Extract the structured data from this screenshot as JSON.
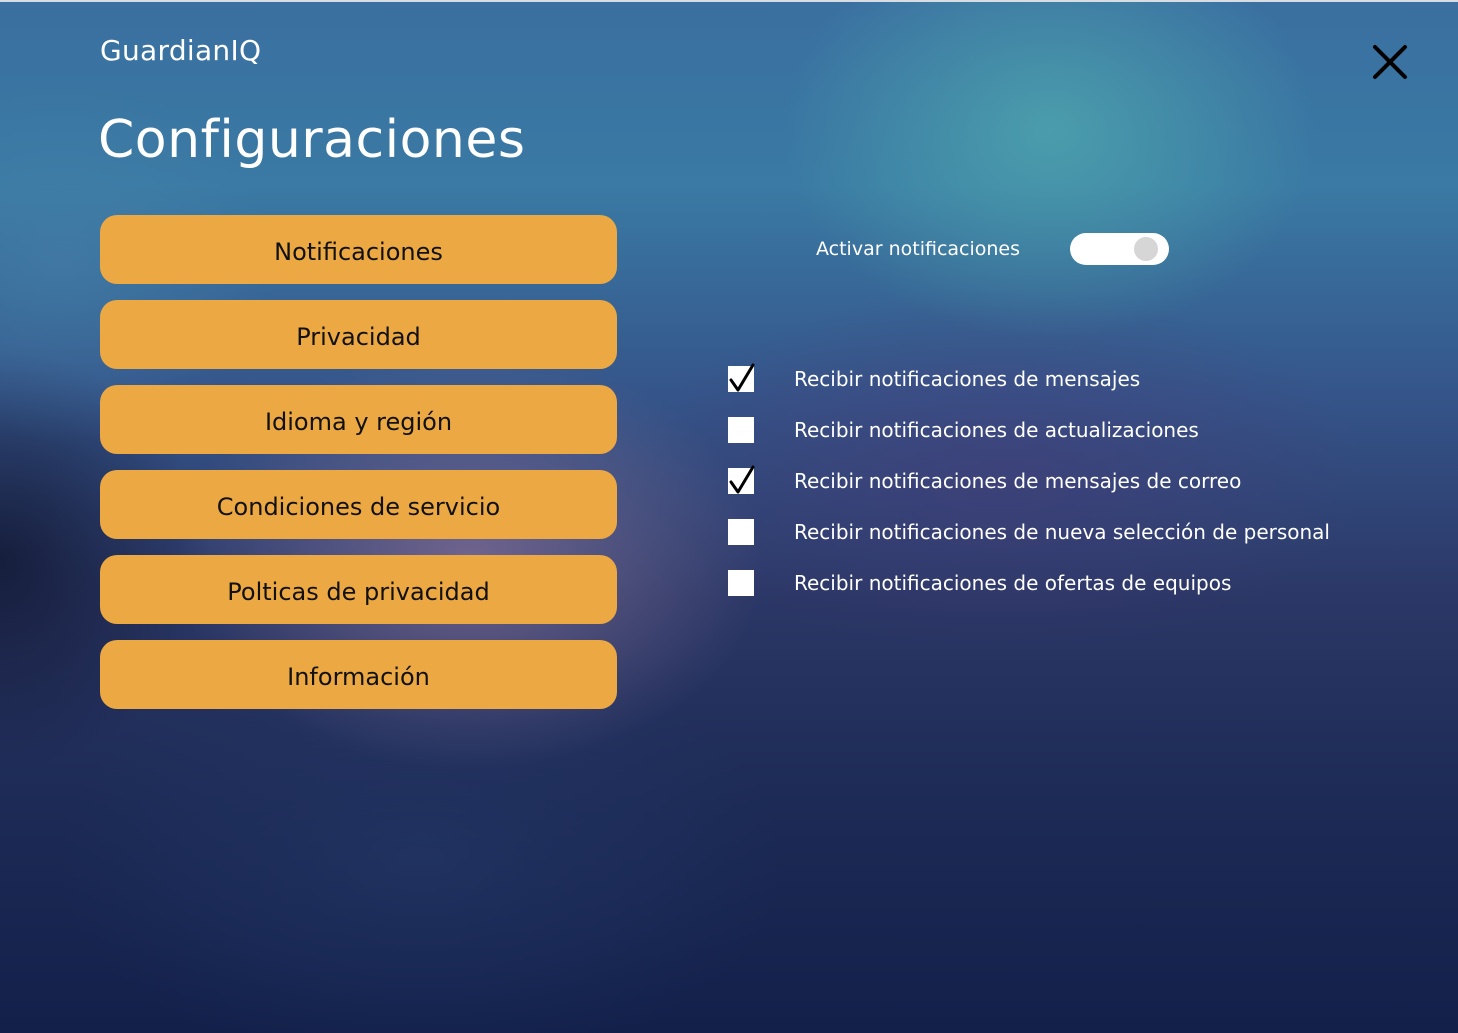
{
  "app": {
    "brand": "GuardianIQ",
    "close_icon": "close-icon"
  },
  "page": {
    "title": "Configuraciones"
  },
  "menu": {
    "items": [
      {
        "label": "Notificaciones"
      },
      {
        "label": "Privacidad"
      },
      {
        "label": "Idioma y región"
      },
      {
        "label": "Condiciones de servicio"
      },
      {
        "label": "Polticas de privacidad"
      },
      {
        "label": "Información"
      }
    ]
  },
  "notifications": {
    "toggle_label": "Activar notificaciones",
    "toggle_on": true,
    "options": [
      {
        "label": "Recibir notificaciones de mensajes",
        "checked": true
      },
      {
        "label": "Recibir notificaciones de actualizaciones",
        "checked": false
      },
      {
        "label": "Recibir notificaciones de mensajes de correo",
        "checked": true
      },
      {
        "label": "Recibir notificaciones de nueva selección de personal",
        "checked": false
      },
      {
        "label": "Recibir notificaciones de ofertas de equipos",
        "checked": false
      }
    ]
  },
  "colors": {
    "button_bg": "#eca842",
    "text": "#ffffff"
  }
}
